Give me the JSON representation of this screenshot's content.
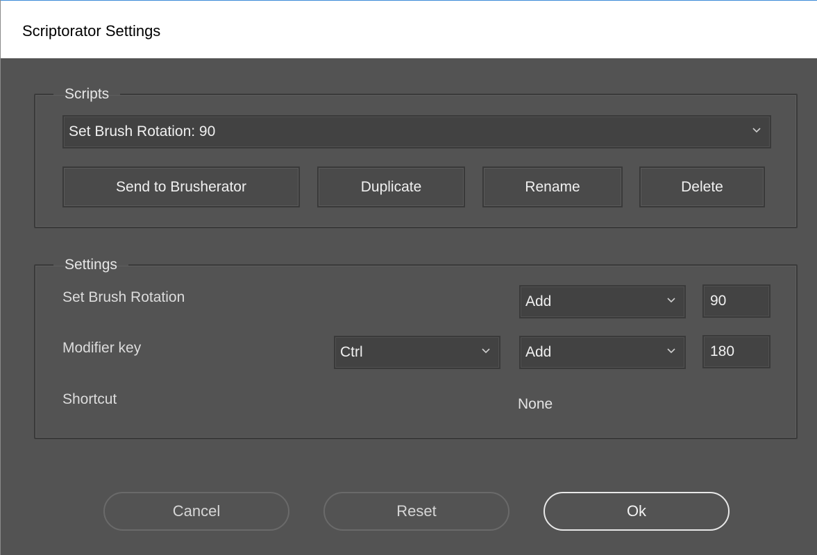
{
  "window": {
    "title": "Scriptorator Settings"
  },
  "scripts": {
    "legend": "Scripts",
    "selected_script": "Set Brush Rotation: 90",
    "buttons": {
      "send": "Send to Brusherator",
      "duplicate": "Duplicate",
      "rename": "Rename",
      "delete": "Delete"
    }
  },
  "settings": {
    "legend": "Settings",
    "rows": {
      "rotation": {
        "label": "Set Brush Rotation",
        "mode": "Add",
        "value": "90"
      },
      "modifier": {
        "label": "Modifier key",
        "key": "Ctrl",
        "mode": "Add",
        "value": "180"
      },
      "shortcut": {
        "label": "Shortcut",
        "value": "None"
      }
    }
  },
  "footer": {
    "cancel": "Cancel",
    "reset": "Reset",
    "ok": "Ok"
  },
  "icons": {
    "dropdown": "chevron-down-icon"
  }
}
